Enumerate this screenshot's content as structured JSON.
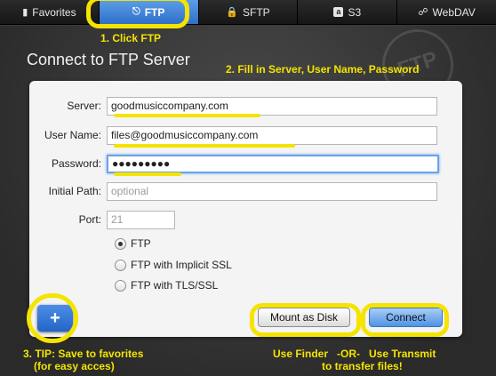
{
  "tabs": [
    {
      "label": "Favorites",
      "icon": "bookmark-icon"
    },
    {
      "label": "FTP",
      "icon": "ftp-icon",
      "active": true
    },
    {
      "label": "SFTP",
      "icon": "lock-icon"
    },
    {
      "label": "S3",
      "icon": "s3-icon"
    },
    {
      "label": "WebDAV",
      "icon": "globe-icon"
    }
  ],
  "heading": "Connect to FTP Server",
  "watermark": "FTP",
  "form": {
    "server_label": "Server:",
    "server_value": "goodmusiccompany.com",
    "username_label": "User Name:",
    "username_value": "files@goodmusiccompany.com",
    "password_label": "Password:",
    "password_value": "●●●●●●●●●",
    "initial_path_label": "Initial Path:",
    "initial_path_placeholder": "optional",
    "port_label": "Port:",
    "port_placeholder": "21",
    "protocols": [
      {
        "label": "FTP",
        "selected": true
      },
      {
        "label": "FTP with Implicit SSL",
        "selected": false
      },
      {
        "label": "FTP with TLS/SSL",
        "selected": false
      }
    ]
  },
  "buttons": {
    "mount": "Mount as Disk",
    "connect": "Connect",
    "add": "+"
  },
  "annotations": {
    "step1": "1. Click FTP",
    "step2": "2. Fill in Server, User Name, Password",
    "step3_line1": "3. TIP: Save to favorites",
    "step3_line2": "(for easy acces)",
    "bottom_line1": "Use Finder   -OR-   Use Transmit",
    "bottom_line2": "to transfer files!"
  },
  "colors": {
    "accent": "#3a7fdc",
    "annotation": "#f4e400",
    "background": "#3a3a3a"
  }
}
